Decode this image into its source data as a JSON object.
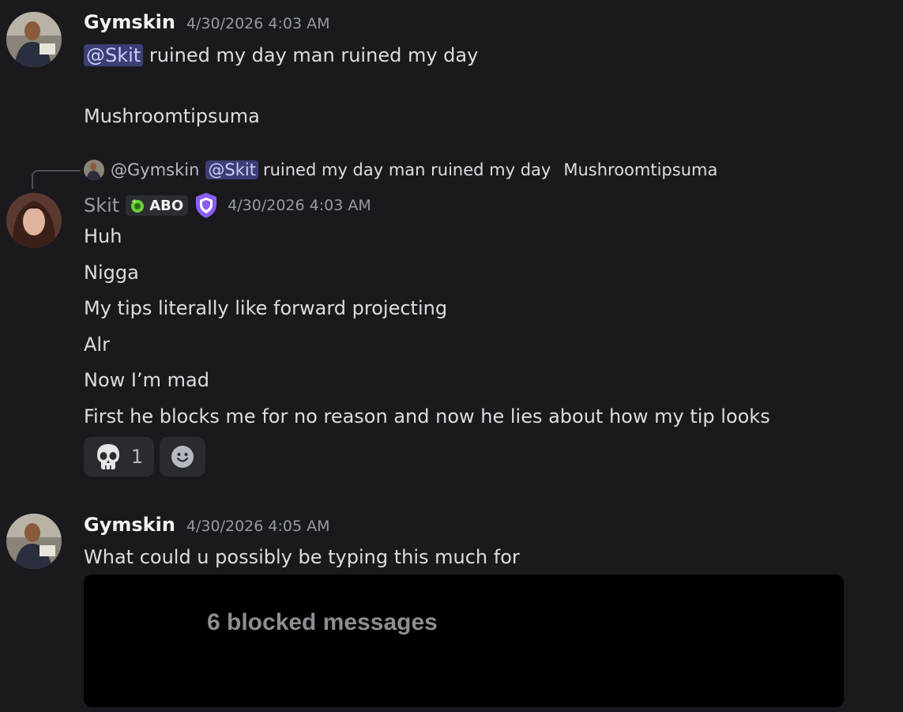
{
  "messages": [
    {
      "username": "Gymskin",
      "timestamp": "4/30/2026 4:03 AM",
      "mention": "@Skit",
      "line1_rest": "ruined my day man ruined my day",
      "line2": "Mushroomtipsuma"
    },
    {
      "reply": {
        "author": "@Gymskin",
        "mention": "@Skit",
        "text": "ruined my day man ruined my day",
        "text2": "Mushroomtipsuma"
      },
      "username": "Skit",
      "tag": "ABO",
      "timestamp": "4/30/2026 4:03 AM",
      "lines": [
        "Huh",
        "Nigga",
        "My tips literally like forward projecting",
        "Alr",
        "Now I’m mad",
        "First he blocks me for no reason and now he lies about how my tip looks"
      ],
      "reactions": [
        {
          "icon": "skull-icon",
          "count": "1"
        },
        {
          "icon": "add-reaction-icon",
          "count": ""
        }
      ]
    },
    {
      "username": "Gymskin",
      "timestamp": "4/30/2026 4:05 AM",
      "text": "What could u possibly be typing this much for",
      "blocked": "6 blocked messages"
    }
  ],
  "colors": {
    "background": "#1a1a1e",
    "mention_bg": "#3c3e76",
    "mention_text": "#c9cdfb",
    "shield": "#8b5cf6"
  }
}
